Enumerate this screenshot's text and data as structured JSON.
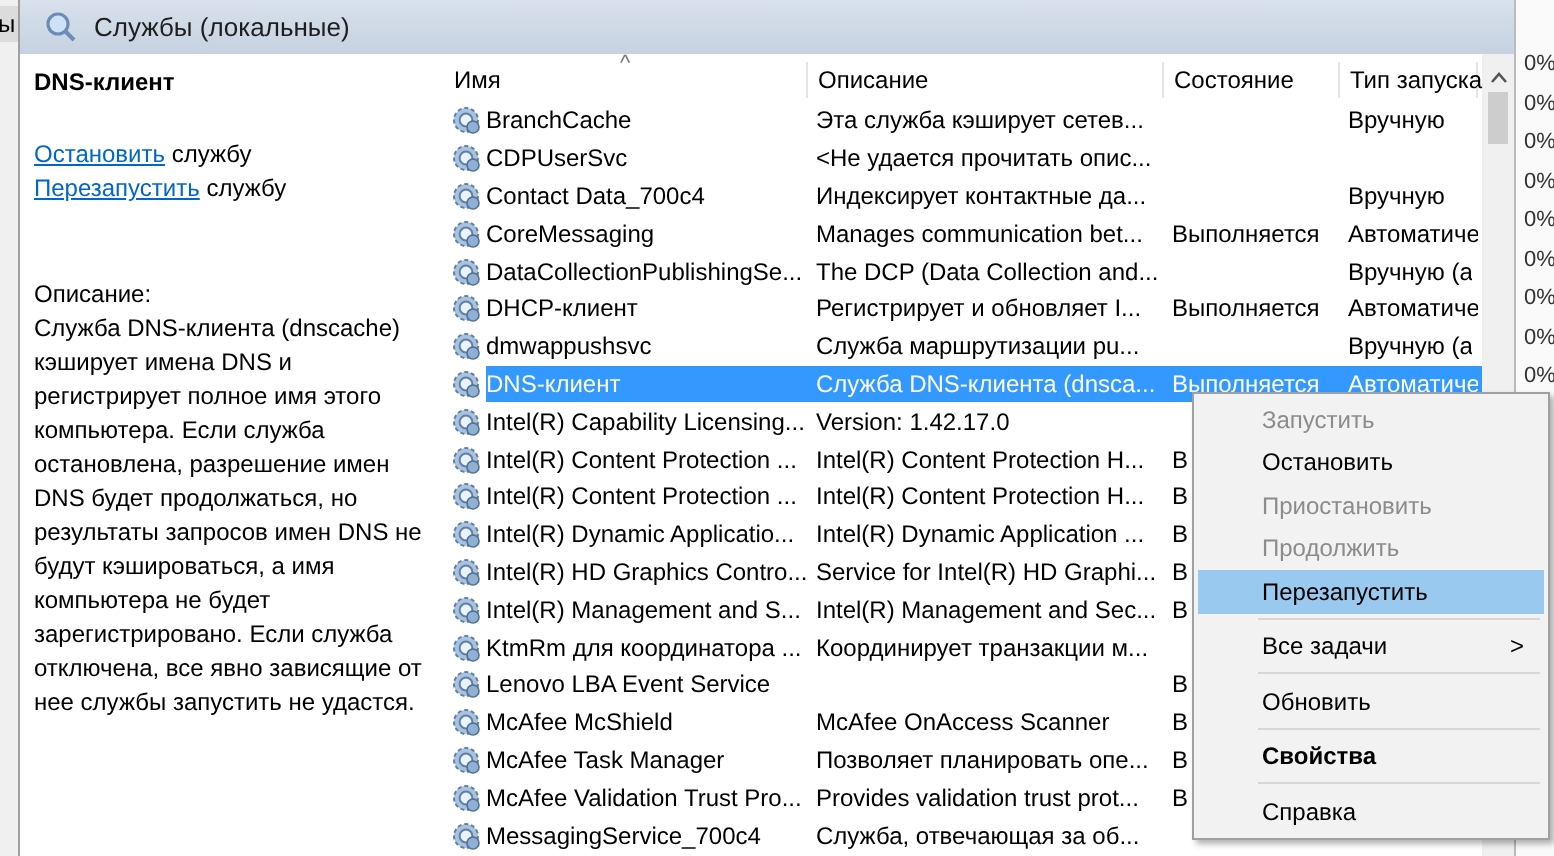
{
  "left_edge_text": "ы",
  "header": {
    "title": "Службы (локальные)"
  },
  "details": {
    "title": "DNS-клиент",
    "actions": [
      {
        "link": "Остановить",
        "rest": "службу"
      },
      {
        "link": "Перезапустить",
        "rest": "службу"
      }
    ],
    "description_label": "Описание:",
    "description": "Служба DNS-клиента (dnscache) кэширует имена DNS и регистрирует полное имя этого компьютера. Если служба остановлена, разрешение имен DNS будет продолжаться, но результаты запросов имен DNS не будут кэшироваться, а имя компьютера не будет зарегистрировано. Если служба отключена, все явно зависящие от нее службы запустить не удастся."
  },
  "table": {
    "sort_indicator": "^",
    "columns": [
      "Имя",
      "Описание",
      "Состояние",
      "Тип запуска"
    ],
    "rows": [
      {
        "name": "BranchCache",
        "description": "Эта служба кэширует сетев...",
        "state": "",
        "startup": "Вручную",
        "selected": false
      },
      {
        "name": "CDPUserSvc",
        "description": "<Не удается прочитать опис...",
        "state": "",
        "startup": "",
        "selected": false
      },
      {
        "name": "Contact Data_700c4",
        "description": "Индексирует контактные да...",
        "state": "",
        "startup": "Вручную",
        "selected": false
      },
      {
        "name": "CoreMessaging",
        "description": "Manages communication bet...",
        "state": "Выполняется",
        "startup": "Автоматиче",
        "selected": false
      },
      {
        "name": "DataCollectionPublishingSe...",
        "description": "The DCP (Data Collection and...",
        "state": "",
        "startup": "Вручную (а",
        "selected": false
      },
      {
        "name": "DHCP-клиент",
        "description": "Регистрирует и обновляет I...",
        "state": "Выполняется",
        "startup": "Автоматиче",
        "selected": false
      },
      {
        "name": "dmwappushsvc",
        "description": "Служба маршрутизации pu...",
        "state": "",
        "startup": "Вручную (а",
        "selected": false
      },
      {
        "name": "DNS-клиент",
        "description": "Служба DNS-клиента (dnsca...",
        "state": "Выполняется",
        "startup": "Автоматиче",
        "selected": true
      },
      {
        "name": "Intel(R) Capability Licensing...",
        "description": "Version: 1.42.17.0",
        "state": "",
        "startup": "",
        "selected": false
      },
      {
        "name": "Intel(R) Content Protection ...",
        "description": "Intel(R) Content Protection H...",
        "state": "В",
        "startup": "",
        "selected": false
      },
      {
        "name": "Intel(R) Content Protection ...",
        "description": "Intel(R) Content Protection H...",
        "state": "В",
        "startup": "",
        "selected": false
      },
      {
        "name": "Intel(R) Dynamic Applicatio...",
        "description": "Intel(R) Dynamic Application ...",
        "state": "В",
        "startup": "",
        "selected": false
      },
      {
        "name": "Intel(R) HD Graphics Contro...",
        "description": "Service for Intel(R) HD Graphi...",
        "state": "В",
        "startup": "",
        "selected": false
      },
      {
        "name": "Intel(R) Management and S...",
        "description": "Intel(R) Management and Sec...",
        "state": "В",
        "startup": "",
        "selected": false
      },
      {
        "name": "KtmRm для координатора ...",
        "description": "Координирует транзакции м...",
        "state": "",
        "startup": "",
        "selected": false
      },
      {
        "name": "Lenovo LBA Event Service",
        "description": "",
        "state": "В",
        "startup": "",
        "selected": false
      },
      {
        "name": "McAfee McShield",
        "description": "McAfee OnAccess Scanner",
        "state": "В",
        "startup": "",
        "selected": false
      },
      {
        "name": "McAfee Task Manager",
        "description": "Позволяет планировать опе...",
        "state": "В",
        "startup": "",
        "selected": false
      },
      {
        "name": "McAfee Validation Trust Pro...",
        "description": "Provides validation trust prot...",
        "state": "В",
        "startup": "",
        "selected": false
      },
      {
        "name": "MessagingService_700c4",
        "description": "Служба, отвечающая за об...",
        "state": "",
        "startup": "",
        "selected": false
      }
    ]
  },
  "context_menu": [
    {
      "kind": "item",
      "label": "Запустить",
      "disabled": true,
      "selected": false,
      "default": false
    },
    {
      "kind": "item",
      "label": "Остановить",
      "disabled": false,
      "selected": false,
      "default": false
    },
    {
      "kind": "item",
      "label": "Приостановить",
      "disabled": true,
      "selected": false,
      "default": false
    },
    {
      "kind": "item",
      "label": "Продолжить",
      "disabled": true,
      "selected": false,
      "default": false
    },
    {
      "kind": "item",
      "label": "Перезапустить",
      "disabled": false,
      "selected": true,
      "default": false
    },
    {
      "kind": "separator"
    },
    {
      "kind": "submenu",
      "label": "Все задачи",
      "arrow": ">",
      "disabled": false,
      "selected": false,
      "default": false
    },
    {
      "kind": "separator"
    },
    {
      "kind": "item",
      "label": "Обновить",
      "disabled": false,
      "selected": false,
      "default": false
    },
    {
      "kind": "separator"
    },
    {
      "kind": "item",
      "label": "Свойства",
      "disabled": false,
      "selected": false,
      "default": true
    },
    {
      "kind": "separator"
    },
    {
      "kind": "item",
      "label": "Справка",
      "disabled": false,
      "selected": false,
      "default": false
    }
  ],
  "right_edge_values": [
    "0%",
    "0%",
    "0%",
    "0%",
    "0%",
    "0%",
    "0%",
    "0%",
    "0%"
  ]
}
